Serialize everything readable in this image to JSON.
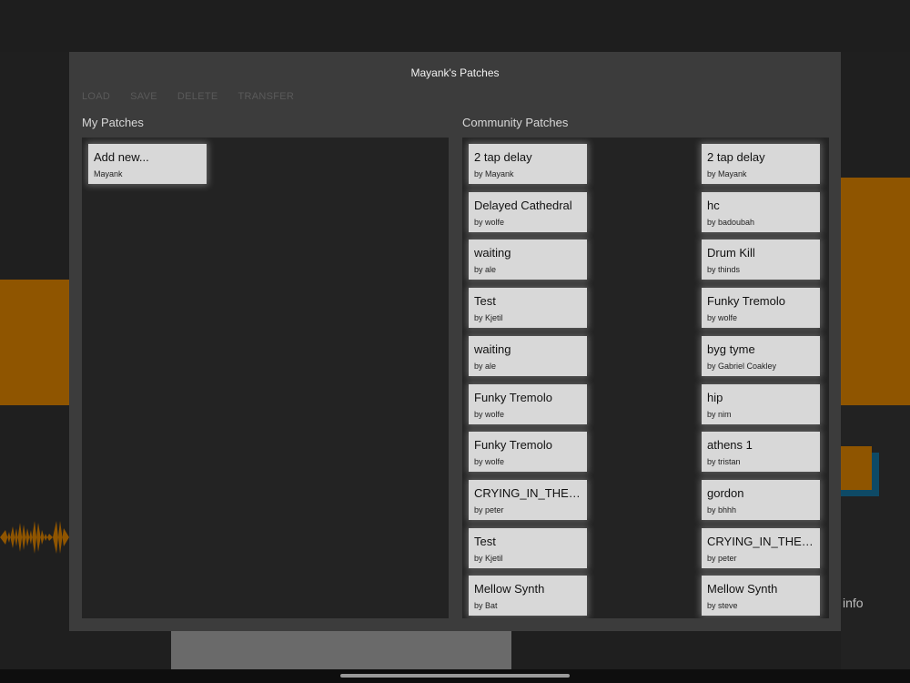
{
  "modal": {
    "title": "Mayank's Patches",
    "toolbar": [
      "LOAD",
      "SAVE",
      "DELETE",
      "TRANSFER"
    ],
    "my_patches_label": "My Patches",
    "community_patches_label": "Community Patches"
  },
  "my_patches": [
    {
      "name": "Add new...",
      "by": "Mayank"
    }
  ],
  "community_left": [
    {
      "name": "2 tap delay",
      "by": "by Mayank"
    },
    {
      "name": "Delayed Cathedral",
      "by": "by wolfe"
    },
    {
      "name": "waiting",
      "by": "by ale"
    },
    {
      "name": "Test",
      "by": "by Kjetil"
    },
    {
      "name": "waiting",
      "by": "by ale"
    },
    {
      "name": "Funky Tremolo",
      "by": "by wolfe"
    },
    {
      "name": "Funky Tremolo",
      "by": "by wolfe"
    },
    {
      "name": "CRYING_IN_THE_...",
      "by": "by peter"
    },
    {
      "name": "Test",
      "by": "by Kjetil"
    },
    {
      "name": "Mellow Synth",
      "by": "by Bat"
    }
  ],
  "community_right": [
    {
      "name": "2 tap delay",
      "by": "by Mayank"
    },
    {
      "name": "hc",
      "by": "by badoubah"
    },
    {
      "name": "Drum Kill",
      "by": "by thinds"
    },
    {
      "name": "Funky Tremolo",
      "by": "by wolfe"
    },
    {
      "name": "byg tyme",
      "by": "by Gabriel Coakley"
    },
    {
      "name": "hip",
      "by": "by nim"
    },
    {
      "name": "athens 1",
      "by": "by tristan"
    },
    {
      "name": "gordon",
      "by": "by bhhh"
    },
    {
      "name": "CRYING_IN_THE_...",
      "by": "by peter"
    },
    {
      "name": "Mellow Synth",
      "by": "by steve"
    }
  ],
  "background": {
    "info_label": "info"
  },
  "colors": {
    "accent_orange": "#8f5500",
    "modal_bg": "#3c3c3c",
    "panel_bg": "#232323",
    "card_bg": "#d8d8d8"
  }
}
